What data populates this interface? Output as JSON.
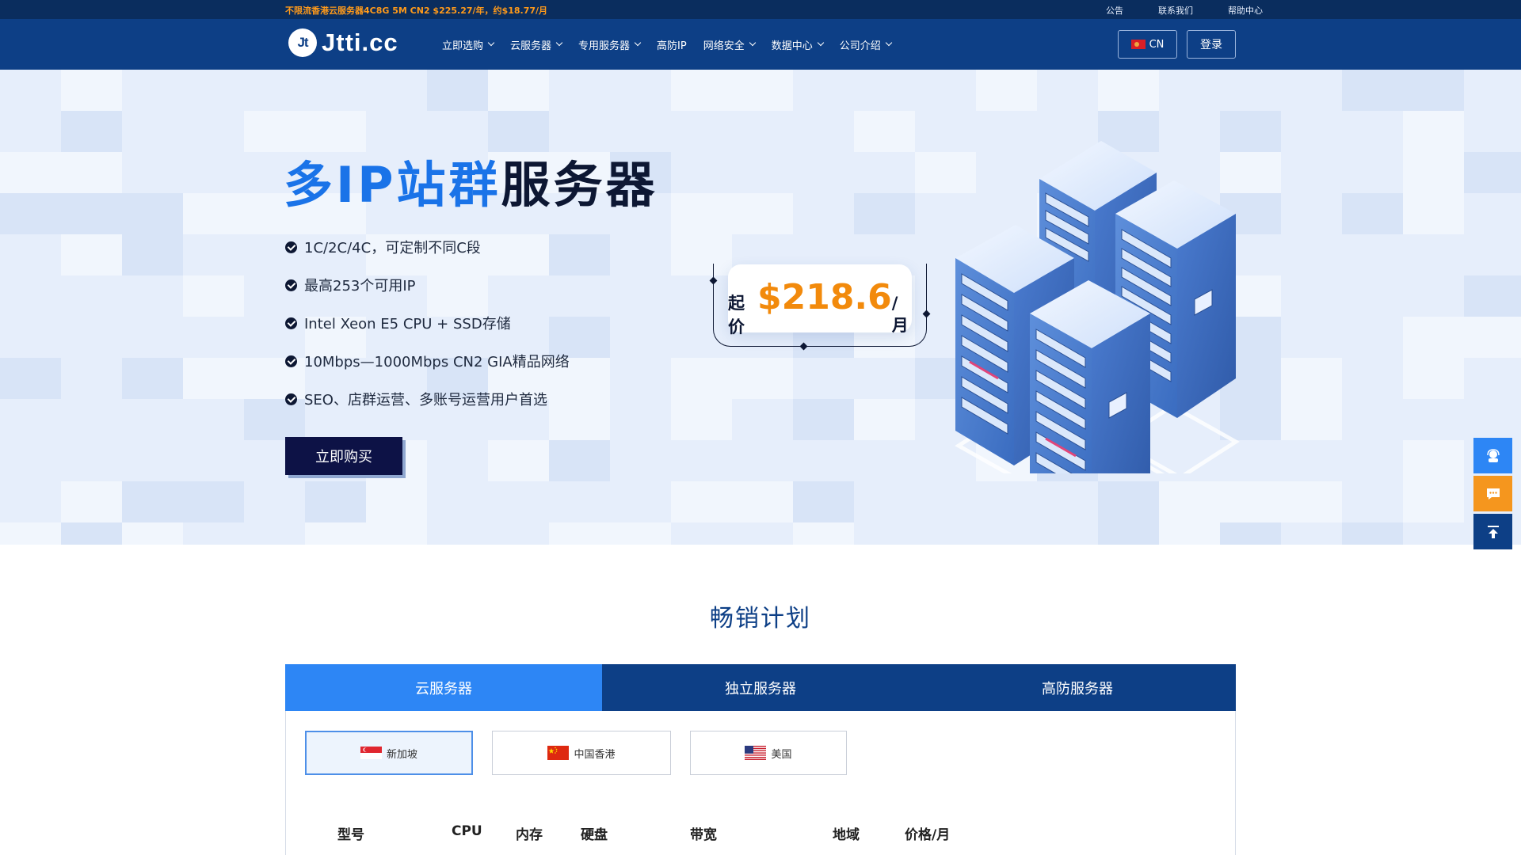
{
  "topbar": {
    "promo": "不限流香港云服务器4C8G 5M CN2 $225.27/年，约$18.77/月",
    "links": [
      "公告",
      "联系我们",
      "帮助中心"
    ]
  },
  "brand": {
    "logo_mark": "Jt",
    "logo_text": "Jtti.cc"
  },
  "nav": {
    "items": [
      {
        "label": "立即选购",
        "dropdown": true
      },
      {
        "label": "云服务器",
        "dropdown": true
      },
      {
        "label": "专用服务器",
        "dropdown": true
      },
      {
        "label": "高防IP",
        "dropdown": false
      },
      {
        "label": "网络安全",
        "dropdown": true
      },
      {
        "label": "数据中心",
        "dropdown": true
      },
      {
        "label": "公司介绍",
        "dropdown": true
      }
    ],
    "language": "CN",
    "login": "登录"
  },
  "hero": {
    "title_highlight": "多IP站群",
    "title_rest": "服务器",
    "features": [
      "1C/2C/4C，可定制不同C段",
      "最高253个可用IP",
      "Intel Xeon E5 CPU + SSD存储",
      "10Mbps—1000Mbps CN2 GIA精品网络",
      "SEO、店群运营、多账号运营用户首选"
    ],
    "buy_button": "立即购买",
    "price_prefix": "起价",
    "price_amount": "$218.6",
    "price_unit": "/月"
  },
  "section": {
    "title": "畅销计划",
    "tabs": [
      "云服务器",
      "独立服务器",
      "高防服务器"
    ],
    "regions": [
      "新加坡",
      "中国香港",
      "美国"
    ],
    "table_headers": [
      "型号",
      "CPU",
      "内存",
      "硬盘",
      "带宽",
      "地域",
      "价格/月"
    ]
  },
  "colors": {
    "topbar": "#0a2d5e",
    "navbar": "#0d3f86",
    "accent_blue": "#1a73e8",
    "price_orange": "#f28a0c",
    "active_tab": "#2d86f5",
    "buy_button": "#0d1246",
    "side_support": "#2d86f5",
    "side_chat": "#f5961e",
    "side_top": "#0d3f86"
  },
  "side_buttons": [
    "support-agent-icon",
    "chat-bubble-icon",
    "back-to-top-icon"
  ]
}
